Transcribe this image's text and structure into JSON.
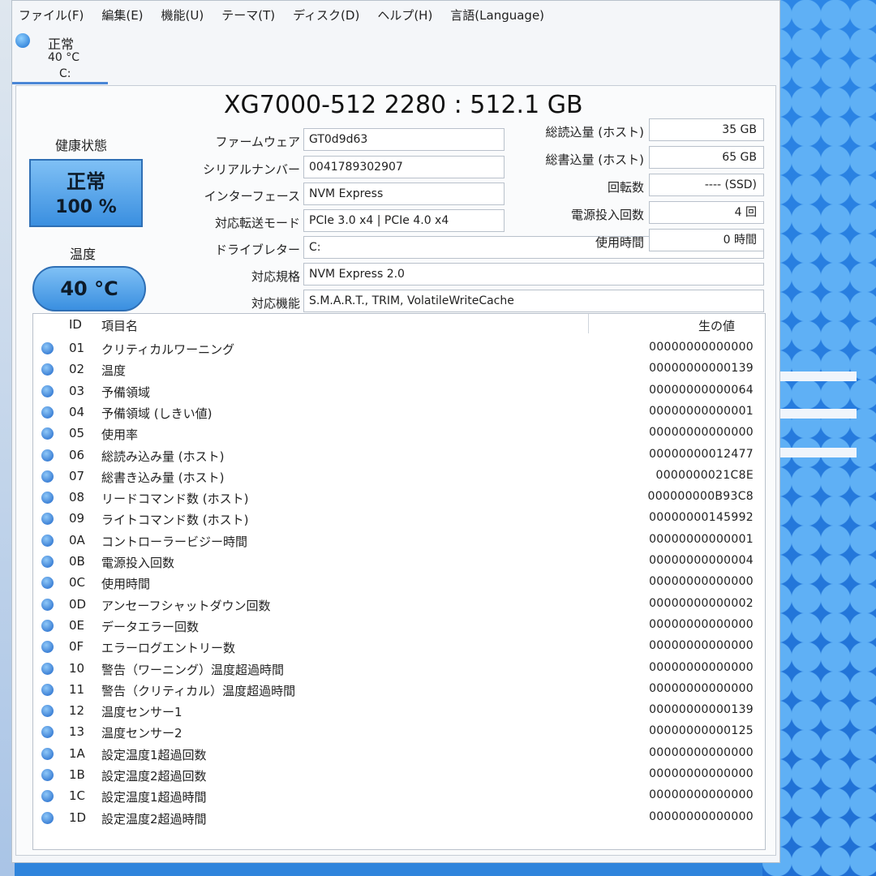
{
  "menu": [
    "ファイル(F)",
    "編集(E)",
    "機能(U)",
    "テーマ(T)",
    "ディスク(D)",
    "ヘルプ(H)",
    "言語(Language)"
  ],
  "disk_tab": {
    "status": "正常",
    "temp": "40 °C",
    "letter": "C:"
  },
  "title": "XG7000-512 2280 : 512.1 GB",
  "health": {
    "label": "健康状態",
    "status": "正常",
    "percent": "100 %"
  },
  "temperature": {
    "label": "温度",
    "value": "40 °C"
  },
  "info": {
    "firmware": {
      "label": "ファームウェア",
      "value": "GT0d9d63"
    },
    "serial": {
      "label": "シリアルナンバー",
      "value": "0041789302907"
    },
    "interface": {
      "label": "インターフェース",
      "value": "NVM Express"
    },
    "transfer_mode": {
      "label": "対応転送モード",
      "value": "PCIe 3.0 x4 | PCIe 4.0 x4"
    },
    "drive_letter": {
      "label": "ドライブレター",
      "value": "C:"
    },
    "standard": {
      "label": "対応規格",
      "value": "NVM Express 2.0"
    },
    "features": {
      "label": "対応機能",
      "value": "S.M.A.R.T., TRIM, VolatileWriteCache"
    }
  },
  "stats": {
    "total_reads": {
      "label": "総読込量 (ホスト)",
      "value": "35 GB"
    },
    "total_writes": {
      "label": "総書込量 (ホスト)",
      "value": "65 GB"
    },
    "rotation": {
      "label": "回転数",
      "value": "---- (SSD)"
    },
    "power_on_count": {
      "label": "電源投入回数",
      "value": "4 回"
    },
    "power_on_hours": {
      "label": "使用時間",
      "value": "0 時間"
    }
  },
  "table": {
    "headers": {
      "id": "ID",
      "name": "項目名",
      "raw": "生の値"
    },
    "rows": [
      {
        "id": "01",
        "name": "クリティカルワーニング",
        "raw": "00000000000000"
      },
      {
        "id": "02",
        "name": "温度",
        "raw": "00000000000139"
      },
      {
        "id": "03",
        "name": "予備領域",
        "raw": "00000000000064"
      },
      {
        "id": "04",
        "name": "予備領域 (しきい値)",
        "raw": "00000000000001"
      },
      {
        "id": "05",
        "name": "使用率",
        "raw": "00000000000000"
      },
      {
        "id": "06",
        "name": "総読み込み量 (ホスト)",
        "raw": "00000000012477"
      },
      {
        "id": "07",
        "name": "総書き込み量 (ホスト)",
        "raw": "0000000021C8E"
      },
      {
        "id": "08",
        "name": "リードコマンド数 (ホスト)",
        "raw": "000000000B93C8"
      },
      {
        "id": "09",
        "name": "ライトコマンド数 (ホスト)",
        "raw": "00000000145992"
      },
      {
        "id": "0A",
        "name": "コントローラービジー時間",
        "raw": "00000000000001"
      },
      {
        "id": "0B",
        "name": "電源投入回数",
        "raw": "00000000000004"
      },
      {
        "id": "0C",
        "name": "使用時間",
        "raw": "00000000000000"
      },
      {
        "id": "0D",
        "name": "アンセーフシャットダウン回数",
        "raw": "00000000000002"
      },
      {
        "id": "0E",
        "name": "データエラー回数",
        "raw": "00000000000000"
      },
      {
        "id": "0F",
        "name": "エラーログエントリー数",
        "raw": "00000000000000"
      },
      {
        "id": "10",
        "name": "警告（ワーニング）温度超過時間",
        "raw": "00000000000000"
      },
      {
        "id": "11",
        "name": "警告（クリティカル）温度超過時間",
        "raw": "00000000000000"
      },
      {
        "id": "12",
        "name": "温度センサー1",
        "raw": "00000000000139"
      },
      {
        "id": "13",
        "name": "温度センサー2",
        "raw": "00000000000125"
      },
      {
        "id": "1A",
        "name": "設定温度1超過回数",
        "raw": "00000000000000"
      },
      {
        "id": "1B",
        "name": "設定温度2超過回数",
        "raw": "00000000000000"
      },
      {
        "id": "1C",
        "name": "設定温度1超過時間",
        "raw": "00000000000000"
      },
      {
        "id": "1D",
        "name": "設定温度2超過時間",
        "raw": "00000000000000"
      }
    ]
  }
}
